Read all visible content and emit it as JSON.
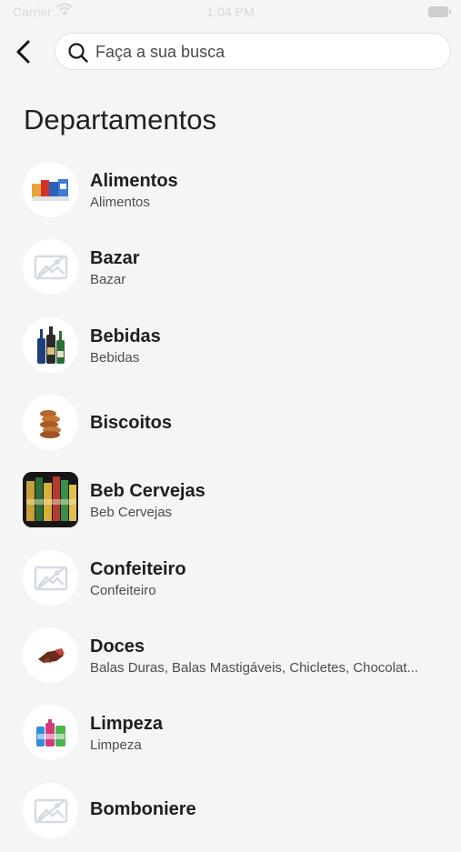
{
  "status_bar": {
    "carrier": "Carrier",
    "time": "1:04 PM"
  },
  "search": {
    "placeholder": "Faça a sua busca"
  },
  "title": "Departamentos",
  "departments": [
    {
      "name": "Alimentos",
      "subtitle": "Alimentos",
      "icon": "food-products-image"
    },
    {
      "name": "Bazar",
      "subtitle": "Bazar",
      "icon": "image-placeholder-icon"
    },
    {
      "name": "Bebidas",
      "subtitle": "Bebidas",
      "icon": "bottles-image"
    },
    {
      "name": "Biscoitos",
      "subtitle": "",
      "icon": "biscuits-image"
    },
    {
      "name": "Beb Cervejas",
      "subtitle": "Beb Cervejas",
      "icon": "beers-image"
    },
    {
      "name": "Confeiteiro",
      "subtitle": "Confeiteiro",
      "icon": "image-placeholder-icon"
    },
    {
      "name": "Doces",
      "subtitle": "Balas Duras, Balas Mastigáveis, Chicletes, Chocolat...",
      "icon": "sweets-image"
    },
    {
      "name": "Limpeza",
      "subtitle": "Limpeza",
      "icon": "cleaning-products-image"
    },
    {
      "name": "Bomboniere",
      "subtitle": "",
      "icon": "image-placeholder-icon"
    }
  ]
}
